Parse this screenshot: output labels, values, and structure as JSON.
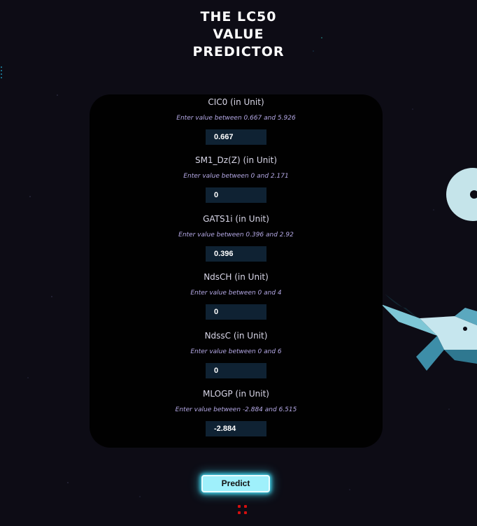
{
  "page": {
    "title_lines": [
      "THE LC50",
      "VALUE",
      "PREDICTOR"
    ]
  },
  "form": {
    "fields": [
      {
        "label": "CIC0 (in Unit)",
        "hint": "Enter value between 0.667 and 5.926",
        "value": "0.667"
      },
      {
        "label": "SM1_Dz(Z) (in Unit)",
        "hint": "Enter value between 0 and 2.171",
        "value": "0"
      },
      {
        "label": "GATS1i (in Unit)",
        "hint": "Enter value between 0.396 and 2.92",
        "value": "0.396"
      },
      {
        "label": "NdsCH (in Unit)",
        "hint": "Enter value between 0 and 4",
        "value": "0"
      },
      {
        "label": "NdssC (in Unit)",
        "hint": "Enter value between 0 and 6",
        "value": "0"
      },
      {
        "label": "MLOGP (in Unit)",
        "hint": "Enter value between -2.884 and 6.515",
        "value": "-2.884"
      }
    ],
    "predict_label": "Predict"
  },
  "theme": {
    "background": "#0d0c15",
    "panel": "#010101",
    "input_bg": "#0f2233",
    "hint_color": "#b5a9e6",
    "button_color": "#9ff0fb",
    "loader_color": "#d40f0f"
  },
  "icons": {
    "loader": "loading-dots-icon",
    "decor_moon": "moon-icon",
    "decor_fish": "fish-icon"
  }
}
